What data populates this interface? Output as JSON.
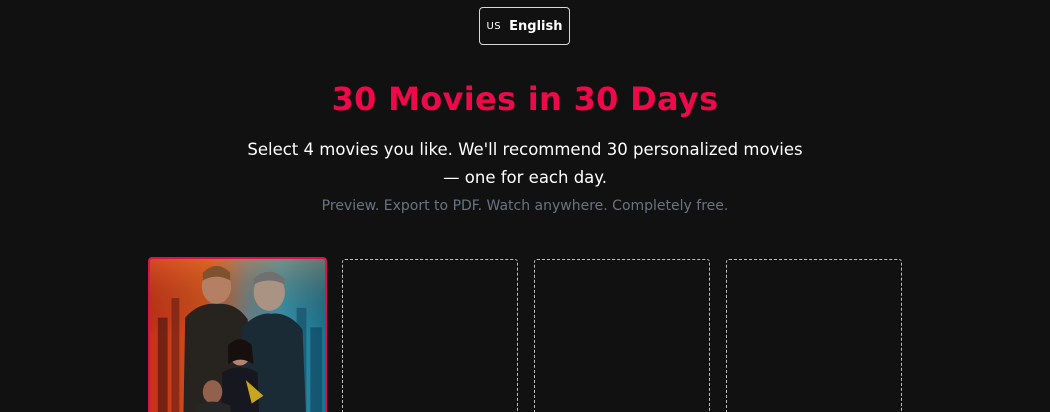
{
  "language": {
    "flag_code": "US",
    "label": "English"
  },
  "hero": {
    "title": "30 Movies in 30 Days",
    "subtitle": "Select 4 movies you like. We'll recommend 30 personalized movies — one for each day.",
    "tagline": "Preview. Export to PDF. Watch anywhere. Completely free."
  },
  "colors": {
    "accent": "#f0094a",
    "background": "#111111",
    "muted_text": "#6b7280"
  },
  "movie_slots": [
    {
      "state": "selected"
    },
    {
      "state": "empty"
    },
    {
      "state": "empty"
    },
    {
      "state": "empty"
    }
  ]
}
